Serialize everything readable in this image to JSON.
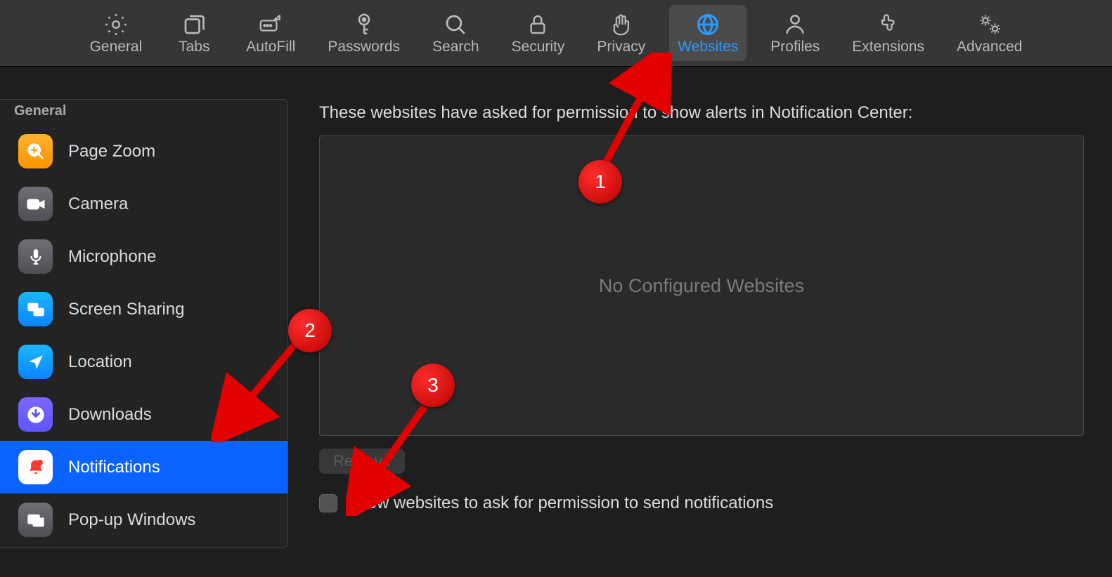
{
  "toolbar": {
    "items": [
      {
        "id": "general",
        "label": "General"
      },
      {
        "id": "tabs",
        "label": "Tabs"
      },
      {
        "id": "autofill",
        "label": "AutoFill"
      },
      {
        "id": "passwords",
        "label": "Passwords"
      },
      {
        "id": "search",
        "label": "Search"
      },
      {
        "id": "security",
        "label": "Security"
      },
      {
        "id": "privacy",
        "label": "Privacy"
      },
      {
        "id": "websites",
        "label": "Websites",
        "active": true
      },
      {
        "id": "profiles",
        "label": "Profiles"
      },
      {
        "id": "extensions",
        "label": "Extensions"
      },
      {
        "id": "advanced",
        "label": "Advanced"
      }
    ]
  },
  "sidebar": {
    "section_label": "General",
    "items": [
      {
        "id": "page-zoom",
        "label": "Page Zoom"
      },
      {
        "id": "camera",
        "label": "Camera"
      },
      {
        "id": "microphone",
        "label": "Microphone"
      },
      {
        "id": "screen-sharing",
        "label": "Screen Sharing"
      },
      {
        "id": "location",
        "label": "Location"
      },
      {
        "id": "downloads",
        "label": "Downloads"
      },
      {
        "id": "notifications",
        "label": "Notifications",
        "selected": true
      },
      {
        "id": "popup-windows",
        "label": "Pop-up Windows"
      }
    ]
  },
  "content": {
    "heading": "These websites have asked for permission to show alerts in Notification Center:",
    "empty_text": "No Configured Websites",
    "remove_label": "Remove",
    "checkbox_label": "Allow websites to ask for permission to send notifications",
    "checkbox_checked": false
  },
  "annotations": [
    {
      "n": "1"
    },
    {
      "n": "2"
    },
    {
      "n": "3"
    }
  ]
}
